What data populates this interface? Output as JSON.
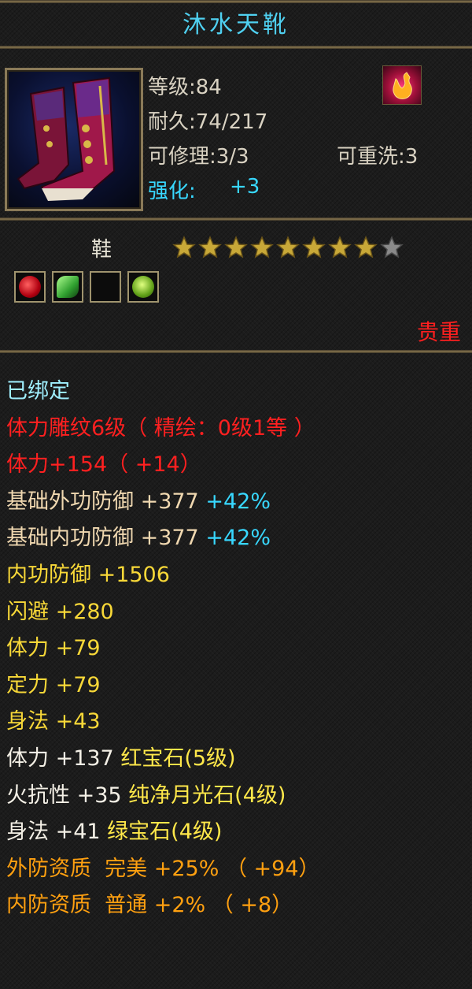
{
  "item": {
    "name": "沐水天靴",
    "level_line": "等级:84",
    "durability_line": "耐久:74/217",
    "repair_line": "可修理:3/3",
    "rewash_line": "可重洗:3",
    "enhance_label": "强化:",
    "enhance_value": "+3",
    "type": "鞋",
    "stars": {
      "filled": 8,
      "total": 9
    },
    "rarity": "贵重",
    "icon": "red-boots-icon",
    "badge_icon": "flame-spirit-icon",
    "gem_slots": [
      {
        "icon": "red-gem-icon",
        "color": "#e02020"
      },
      {
        "icon": "green-jade-icon",
        "color": "#40c040"
      },
      {
        "icon": "empty-slot",
        "color": ""
      },
      {
        "icon": "green-gem-icon",
        "color": "#7ac020"
      }
    ]
  },
  "attributes": {
    "bound": "已绑定",
    "carving": "体力雕纹6级（ 精绘：0级1等 ）",
    "stamina_total": "体力+154（ +14）",
    "base_ext_def": {
      "label": "基础外功防御 +377",
      "bonus": "+42%"
    },
    "base_int_def": {
      "label": "基础内功防御 +377",
      "bonus": "+42%"
    },
    "int_def": "内功防御 +1506",
    "dodge": "闪避 +280",
    "stamina": "体力 +79",
    "focus": "定力 +79",
    "agility": "身法 +43",
    "gem_stamina": {
      "label": "体力 +137",
      "gem": "红宝石(5级)"
    },
    "gem_fire": {
      "label": "火抗性 +35",
      "gem": "纯净月光石(4级)"
    },
    "gem_agility": {
      "label": "身法 +41",
      "gem": "绿宝石(4级)"
    },
    "ext_quality": "外防资质  完美 +25% （ +94）",
    "int_quality": "内防资质  普通 +2% （ +8）"
  },
  "colors": {
    "title": "#4fd0f0",
    "rarity": "#ff1f1f",
    "star_filled": "#c8a838",
    "star_empty": "#8a8a8a"
  }
}
